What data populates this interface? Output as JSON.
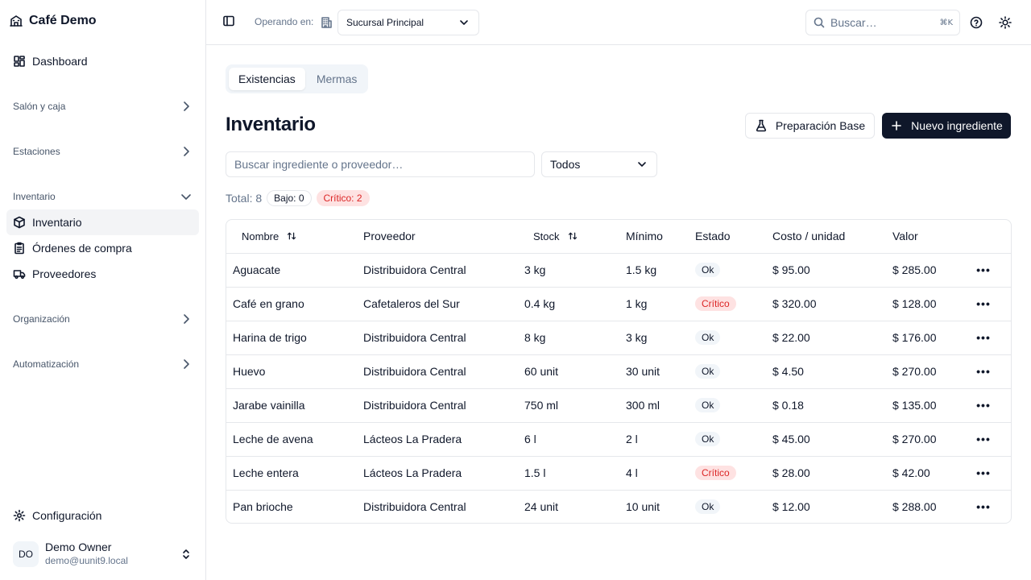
{
  "sidebar": {
    "brand": "Café Demo",
    "dashboard": "Dashboard",
    "groups": {
      "salon": "Salón y caja",
      "estaciones": "Estaciones",
      "inventario": "Inventario",
      "organizacion": "Organización",
      "automatizacion": "Automatización"
    },
    "inventario_items": [
      "Inventario",
      "Órdenes de compra",
      "Proveedores"
    ],
    "config": "Configuración",
    "user": {
      "initials": "DO",
      "name": "Demo Owner",
      "email": "demo@uunit9.local"
    }
  },
  "header": {
    "operating_label": "Operando en:",
    "branch": "Sucursal Principal",
    "search_placeholder": "Buscar…",
    "search_shortcut": "⌘K"
  },
  "tabs": [
    "Existencias",
    "Mermas"
  ],
  "page": {
    "title": "Inventario",
    "btn_prep": "Preparación Base",
    "btn_new": "Nuevo ingrediente",
    "filter_placeholder": "Buscar ingrediente o proveedor…",
    "filter_select": "Todos"
  },
  "summary": {
    "total": "Total: 8",
    "bajo": "Bajo: 0",
    "critico": "Crítico: 2"
  },
  "table": {
    "headers": [
      "Nombre",
      "Proveedor",
      "Stock",
      "Mínimo",
      "Estado",
      "Costo / unidad",
      "Valor"
    ],
    "rows": [
      [
        "Aguacate",
        "Distribuidora Central",
        "3 kg",
        "1.5 kg",
        "Ok",
        "$ 95.00",
        "$ 285.00"
      ],
      [
        "Café en grano",
        "Cafetaleros del Sur",
        "0.4 kg",
        "1 kg",
        "Crítico",
        "$ 320.00",
        "$ 128.00"
      ],
      [
        "Harina de trigo",
        "Distribuidora Central",
        "8 kg",
        "3 kg",
        "Ok",
        "$ 22.00",
        "$ 176.00"
      ],
      [
        "Huevo",
        "Distribuidora Central",
        "60 unit",
        "30 unit",
        "Ok",
        "$ 4.50",
        "$ 270.00"
      ],
      [
        "Jarabe vainilla",
        "Distribuidora Central",
        "750 ml",
        "300 ml",
        "Ok",
        "$ 0.18",
        "$ 135.00"
      ],
      [
        "Leche de avena",
        "Lácteos La Pradera",
        "6 l",
        "2 l",
        "Ok",
        "$ 45.00",
        "$ 270.00"
      ],
      [
        "Leche entera",
        "Lácteos La Pradera",
        "1.5 l",
        "4 l",
        "Crítico",
        "$ 28.00",
        "$ 42.00"
      ],
      [
        "Pan brioche",
        "Distribuidora Central",
        "24 unit",
        "10 unit",
        "Ok",
        "$ 12.00",
        "$ 288.00"
      ]
    ],
    "row_actions": "•••"
  },
  "colors": {
    "primary": "#0f172a",
    "danger": "#dc2626",
    "danger_bg": "#fee2e2",
    "muted": "#64748b",
    "border": "#e5e7eb"
  }
}
